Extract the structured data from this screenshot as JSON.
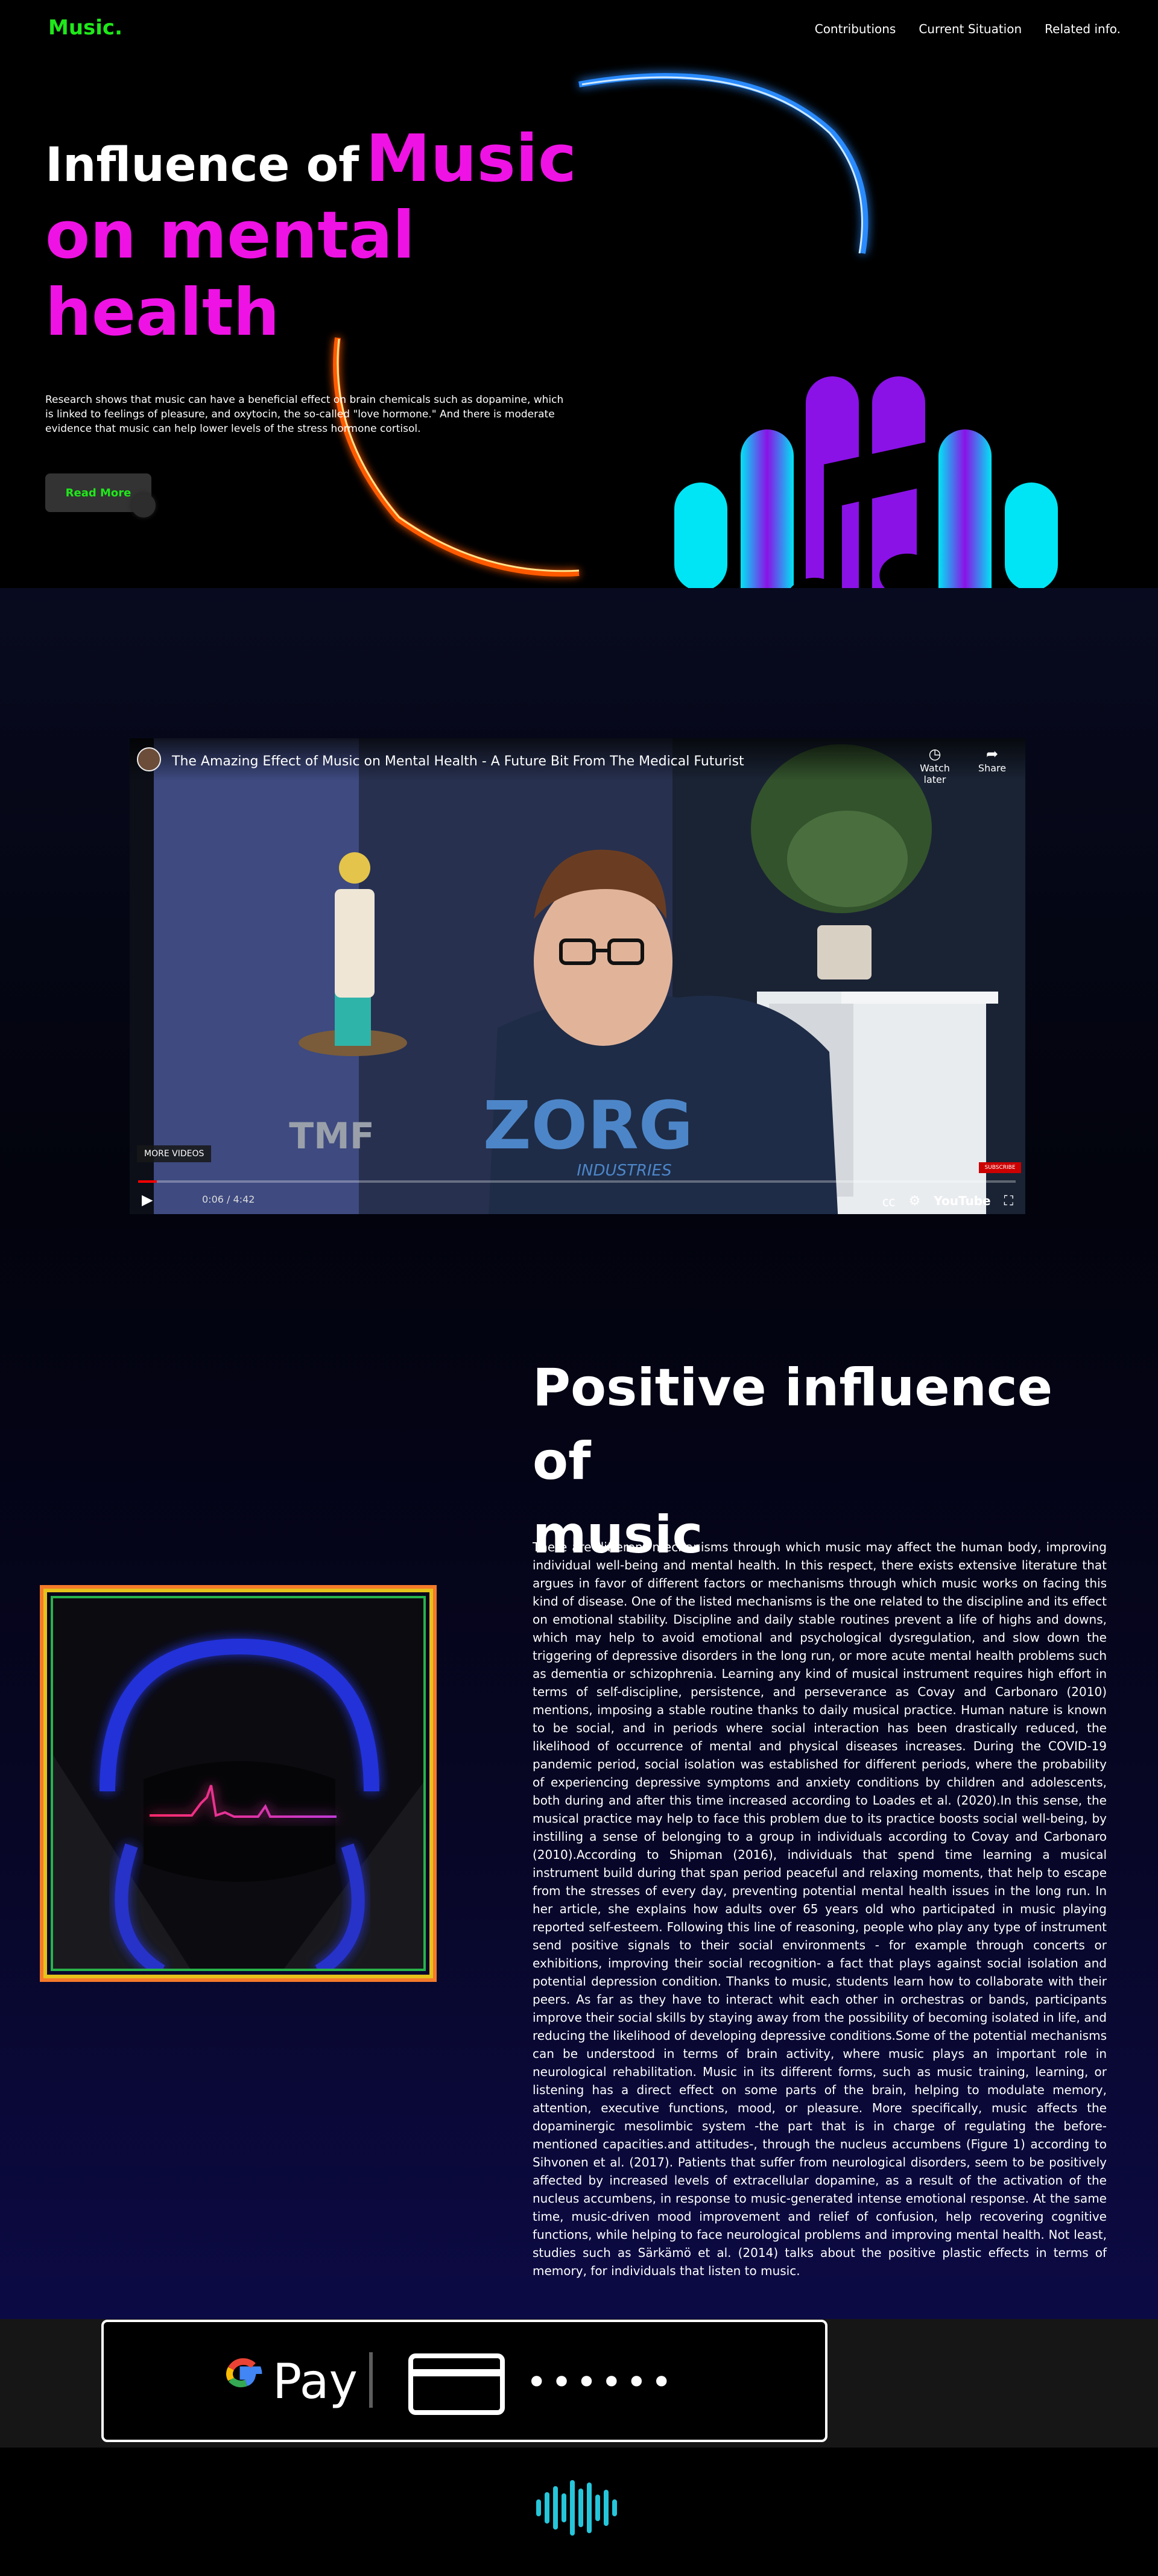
{
  "nav": {
    "logo": "Music.",
    "links": [
      "Contributions",
      "Current Situation",
      "Related info."
    ]
  },
  "hero": {
    "title_prefix": "Influence of",
    "title_highlight": "Music",
    "title_line2": "on mental",
    "title_line3": "health",
    "description": "Research shows that music can have a beneficial effect on brain chemicals such as dopamine, which is linked to feelings of pleasure, and oxytocin, the so-called \"love hormone.\" And there is moderate evidence that music can help lower levels of the stress hormone cortisol.",
    "button": "Read More"
  },
  "video": {
    "title": "The Amazing Effect of Music on Mental Health - A Future Bit From The Medical Futurist",
    "watch_later": "Watch later",
    "share": "Share",
    "more_videos": "MORE VIDEOS",
    "time": "0:06 / 4:42",
    "progress_fraction": 0.021,
    "youtube_label": "YouTube",
    "shirt_text": "ZORG",
    "shirt_subtext": "INDUSTRIES",
    "logo_text": "TMF",
    "subscribe": "SUBSCRIBE"
  },
  "positive": {
    "title_line1": "Positive influence of",
    "title_line2": "music",
    "body": "There are different mechanisms through which music may affect the human body, improving individual well-being and mental health. In this respect, there exists extensive literature that argues in favor of different factors or mechanisms through which music works on facing this kind of disease. One of the listed mechanisms is the one related to the discipline and its effect on emotional stability. Discipline and daily stable routines prevent a life of highs and downs, which may help to avoid emotional and psychological dysregulation, and slow down the triggering of depressive disorders in the long run, or more acute mental health problems such as dementia or schizophrenia. Learning any kind of musical instrument requires high effort in terms of self-discipline, persistence, and perseverance as Covay and Carbonaro (2010) mentions, imposing a stable routine thanks to daily musical practice. Human nature is known to be social, and in periods where social interaction has been drastically reduced, the likelihood of occurrence of mental and physical diseases increases. During the COVID-19 pandemic period, social isolation was established for different periods, where the probability of experiencing depressive symptoms and anxiety conditions by children and adolescents, both during and after this time increased according to Loades et al. (2020).In this sense, the musical practice may help to face this problem due to its practice boosts social well-being, by instilling a sense of belonging to a group in individuals according to Covay and Carbonaro (2010).According to Shipman (2016), individuals that spend time learning a musical instrument build during that span period peaceful and relaxing moments, that help to escape from the stresses of every day, preventing potential mental health issues in the long run. In her article, she explains how adults over 65 years old who participated in music playing reported self-esteem. Following this line of reasoning, people who play any type of instrument send positive signals to their social environments - for example through concerts or exhibitions, improving their social recognition- a fact that plays against social isolation and potential depression condition. Thanks to music, students learn how to collaborate with their peers. As far as they have to interact whit each other in orchestras or bands, participants improve their social skills by staying away from the possibility of becoming isolated in life, and reducing the likelihood of developing depressive conditions.Some of the potential mechanisms can be understood in terms of brain activity, where music plays an important role in neurological rehabilitation. Music in its different forms, such as music training, learning, or listening has a direct effect on some parts of the brain, helping to modulate memory, attention, executive functions, mood, or pleasure. More specifically, music affects the dopaminergic mesolimbic system -the part that is in charge of regulating the before-mentioned capacities.and attitudes-, through the nucleus accumbens (Figure 1) according to Sihvonen et al. (2017). Patients that suffer from neurological disorders, seem to be positively affected by increased levels of extracellular dopamine, as a result of the activation of the nucleus accumbens, in response to music-generated intense emotional response. At the same time, music-driven mood improvement and relief of confusion, help recovering cognitive functions, while helping to face neurological problems and improving mental health. Not least, studies such as Särkämö et al. (2014) talks about the positive plastic effects in terms of memory, for individuals that listen to music."
  },
  "pay": {
    "label": "Pay",
    "dots": "••••••"
  },
  "colors": {
    "accent_green": "#1fe81a",
    "accent_magenta": "#ee13e4",
    "cyan": "#00e5f5",
    "purple": "#8a12e6"
  }
}
